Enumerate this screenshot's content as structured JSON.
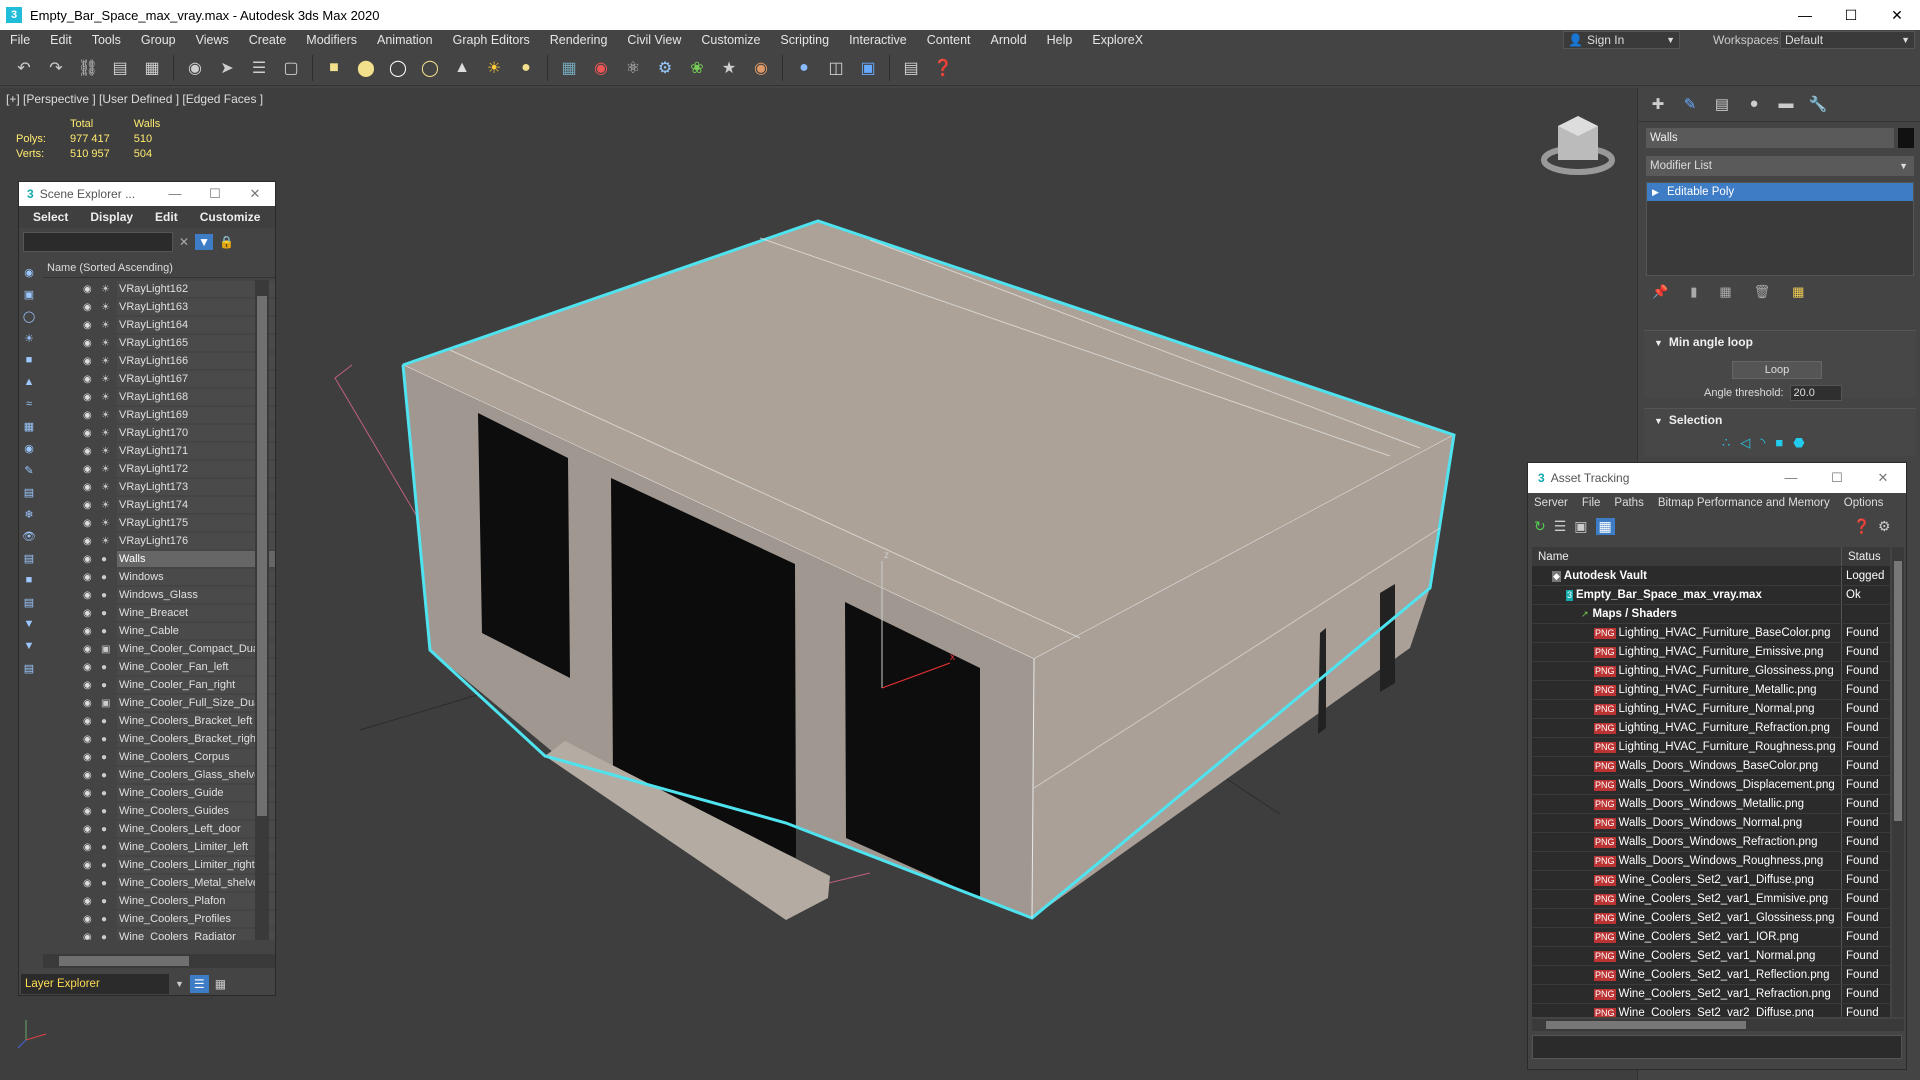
{
  "window": {
    "title": "Empty_Bar_Space_max_vray.max - Autodesk 3ds Max 2020",
    "app_icon": "3"
  },
  "menu": [
    "File",
    "Edit",
    "Tools",
    "Group",
    "Views",
    "Create",
    "Modifiers",
    "Animation",
    "Graph Editors",
    "Rendering",
    "Civil View",
    "Customize",
    "Scripting",
    "Interactive",
    "Content",
    "Arnold",
    "Help",
    "ExploreX"
  ],
  "account": {
    "sign_in": "Sign In",
    "workspaces_label": "Workspaces:",
    "workspace": "Default"
  },
  "viewport": {
    "label": "[+] [Perspective ] [User Defined ] [Edged Faces ]",
    "stats": {
      "col_total": "Total",
      "col_walls": "Walls",
      "polys_label": "Polys:",
      "polys_total": "977 417",
      "polys_walls": "510",
      "verts_label": "Verts:",
      "verts_total": "510 957",
      "verts_walls": "504"
    }
  },
  "scene_explorer": {
    "title": "Scene Explorer ...",
    "menu": [
      "Select",
      "Display",
      "Edit",
      "Customize"
    ],
    "column_header": "Name (Sorted Ascending)",
    "rows": [
      {
        "name": "VRayLight162",
        "icon": "light"
      },
      {
        "name": "VRayLight163",
        "icon": "light"
      },
      {
        "name": "VRayLight164",
        "icon": "light"
      },
      {
        "name": "VRayLight165",
        "icon": "light"
      },
      {
        "name": "VRayLight166",
        "icon": "light"
      },
      {
        "name": "VRayLight167",
        "icon": "light"
      },
      {
        "name": "VRayLight168",
        "icon": "light"
      },
      {
        "name": "VRayLight169",
        "icon": "light"
      },
      {
        "name": "VRayLight170",
        "icon": "light"
      },
      {
        "name": "VRayLight171",
        "icon": "light"
      },
      {
        "name": "VRayLight172",
        "icon": "light"
      },
      {
        "name": "VRayLight173",
        "icon": "light"
      },
      {
        "name": "VRayLight174",
        "icon": "light"
      },
      {
        "name": "VRayLight175",
        "icon": "light"
      },
      {
        "name": "VRayLight176",
        "icon": "light"
      },
      {
        "name": "Walls",
        "icon": "geo",
        "selected": true
      },
      {
        "name": "Windows",
        "icon": "geo"
      },
      {
        "name": "Windows_Glass",
        "icon": "geo"
      },
      {
        "name": "Wine_Breacet",
        "icon": "geo"
      },
      {
        "name": "Wine_Cable",
        "icon": "geo"
      },
      {
        "name": "Wine_Cooler_Compact_Dual_",
        "icon": "group"
      },
      {
        "name": "Wine_Cooler_Fan_left",
        "icon": "geo"
      },
      {
        "name": "Wine_Cooler_Fan_right",
        "icon": "geo"
      },
      {
        "name": "Wine_Cooler_Full_Size_Dual_",
        "icon": "group"
      },
      {
        "name": "Wine_Coolers_Bracket_left",
        "icon": "geo"
      },
      {
        "name": "Wine_Coolers_Bracket_right",
        "icon": "geo"
      },
      {
        "name": "Wine_Coolers_Corpus",
        "icon": "geo"
      },
      {
        "name": "Wine_Coolers_Glass_shelves",
        "icon": "geo"
      },
      {
        "name": "Wine_Coolers_Guide",
        "icon": "geo"
      },
      {
        "name": "Wine_Coolers_Guides",
        "icon": "geo"
      },
      {
        "name": "Wine_Coolers_Left_door",
        "icon": "geo"
      },
      {
        "name": "Wine_Coolers_Limiter_left",
        "icon": "geo"
      },
      {
        "name": "Wine_Coolers_Limiter_right",
        "icon": "geo"
      },
      {
        "name": "Wine_Coolers_Metal_shelves",
        "icon": "geo"
      },
      {
        "name": "Wine_Coolers_Plafon",
        "icon": "geo"
      },
      {
        "name": "Wine_Coolers_Profiles",
        "icon": "geo"
      },
      {
        "name": "Wine_Coolers_Radiator",
        "icon": "geo"
      }
    ],
    "footer_layer": "Layer Explorer"
  },
  "command_panel": {
    "object_name": "Walls",
    "modifier_list": "Modifier List",
    "stack_item": "Editable Poly",
    "rollout_min_angle_loop": "Min angle loop",
    "loop_button": "Loop",
    "angle_threshold_label": "Angle threshold:",
    "angle_threshold_value": "20.0",
    "rollout_selection": "Selection"
  },
  "asset_tracking": {
    "title": "Asset Tracking",
    "menu": [
      "Server",
      "File",
      "Paths",
      "Bitmap Performance and Memory",
      "Options"
    ],
    "col_name": "Name",
    "col_status": "Status",
    "rows": [
      {
        "indent": 1,
        "icon": "vault",
        "name": "Autodesk Vault",
        "status": "Logged"
      },
      {
        "indent": 2,
        "icon": "max",
        "name": "Empty_Bar_Space_max_vray.max",
        "status": "Ok"
      },
      {
        "indent": 3,
        "icon": "folder",
        "name": "Maps / Shaders",
        "status": ""
      },
      {
        "indent": 4,
        "icon": "png",
        "name": "Lighting_HVAC_Furniture_BaseColor.png",
        "status": "Found"
      },
      {
        "indent": 4,
        "icon": "png",
        "name": "Lighting_HVAC_Furniture_Emissive.png",
        "status": "Found"
      },
      {
        "indent": 4,
        "icon": "png",
        "name": "Lighting_HVAC_Furniture_Glossiness.png",
        "status": "Found"
      },
      {
        "indent": 4,
        "icon": "png",
        "name": "Lighting_HVAC_Furniture_Metallic.png",
        "status": "Found"
      },
      {
        "indent": 4,
        "icon": "png",
        "name": "Lighting_HVAC_Furniture_Normal.png",
        "status": "Found"
      },
      {
        "indent": 4,
        "icon": "png",
        "name": "Lighting_HVAC_Furniture_Refraction.png",
        "status": "Found"
      },
      {
        "indent": 4,
        "icon": "png",
        "name": "Lighting_HVAC_Furniture_Roughness.png",
        "status": "Found"
      },
      {
        "indent": 4,
        "icon": "png",
        "name": "Walls_Doors_Windows_BaseColor.png",
        "status": "Found"
      },
      {
        "indent": 4,
        "icon": "png",
        "name": "Walls_Doors_Windows_Displacement.png",
        "status": "Found"
      },
      {
        "indent": 4,
        "icon": "png",
        "name": "Walls_Doors_Windows_Metallic.png",
        "status": "Found"
      },
      {
        "indent": 4,
        "icon": "png",
        "name": "Walls_Doors_Windows_Normal.png",
        "status": "Found"
      },
      {
        "indent": 4,
        "icon": "png",
        "name": "Walls_Doors_Windows_Refraction.png",
        "status": "Found"
      },
      {
        "indent": 4,
        "icon": "png",
        "name": "Walls_Doors_Windows_Roughness.png",
        "status": "Found"
      },
      {
        "indent": 4,
        "icon": "png",
        "name": "Wine_Coolers_Set2_var1_Diffuse.png",
        "status": "Found"
      },
      {
        "indent": 4,
        "icon": "png",
        "name": "Wine_Coolers_Set2_var1_Emmisive.png",
        "status": "Found"
      },
      {
        "indent": 4,
        "icon": "png",
        "name": "Wine_Coolers_Set2_var1_Glossiness.png",
        "status": "Found"
      },
      {
        "indent": 4,
        "icon": "png",
        "name": "Wine_Coolers_Set2_var1_IOR.png",
        "status": "Found"
      },
      {
        "indent": 4,
        "icon": "png",
        "name": "Wine_Coolers_Set2_var1_Normal.png",
        "status": "Found"
      },
      {
        "indent": 4,
        "icon": "png",
        "name": "Wine_Coolers_Set2_var1_Reflection.png",
        "status": "Found"
      },
      {
        "indent": 4,
        "icon": "png",
        "name": "Wine_Coolers_Set2_var1_Refraction.png",
        "status": "Found"
      },
      {
        "indent": 4,
        "icon": "png",
        "name": "Wine_Coolers_Set2_var2_Diffuse.png",
        "status": "Found"
      }
    ]
  },
  "colors": {
    "selection_edge": "#4fe3ef",
    "bbox": "#e06a8a",
    "accent_blue": "#3e7dc6",
    "viewport_bg": "#3e3e3e"
  }
}
